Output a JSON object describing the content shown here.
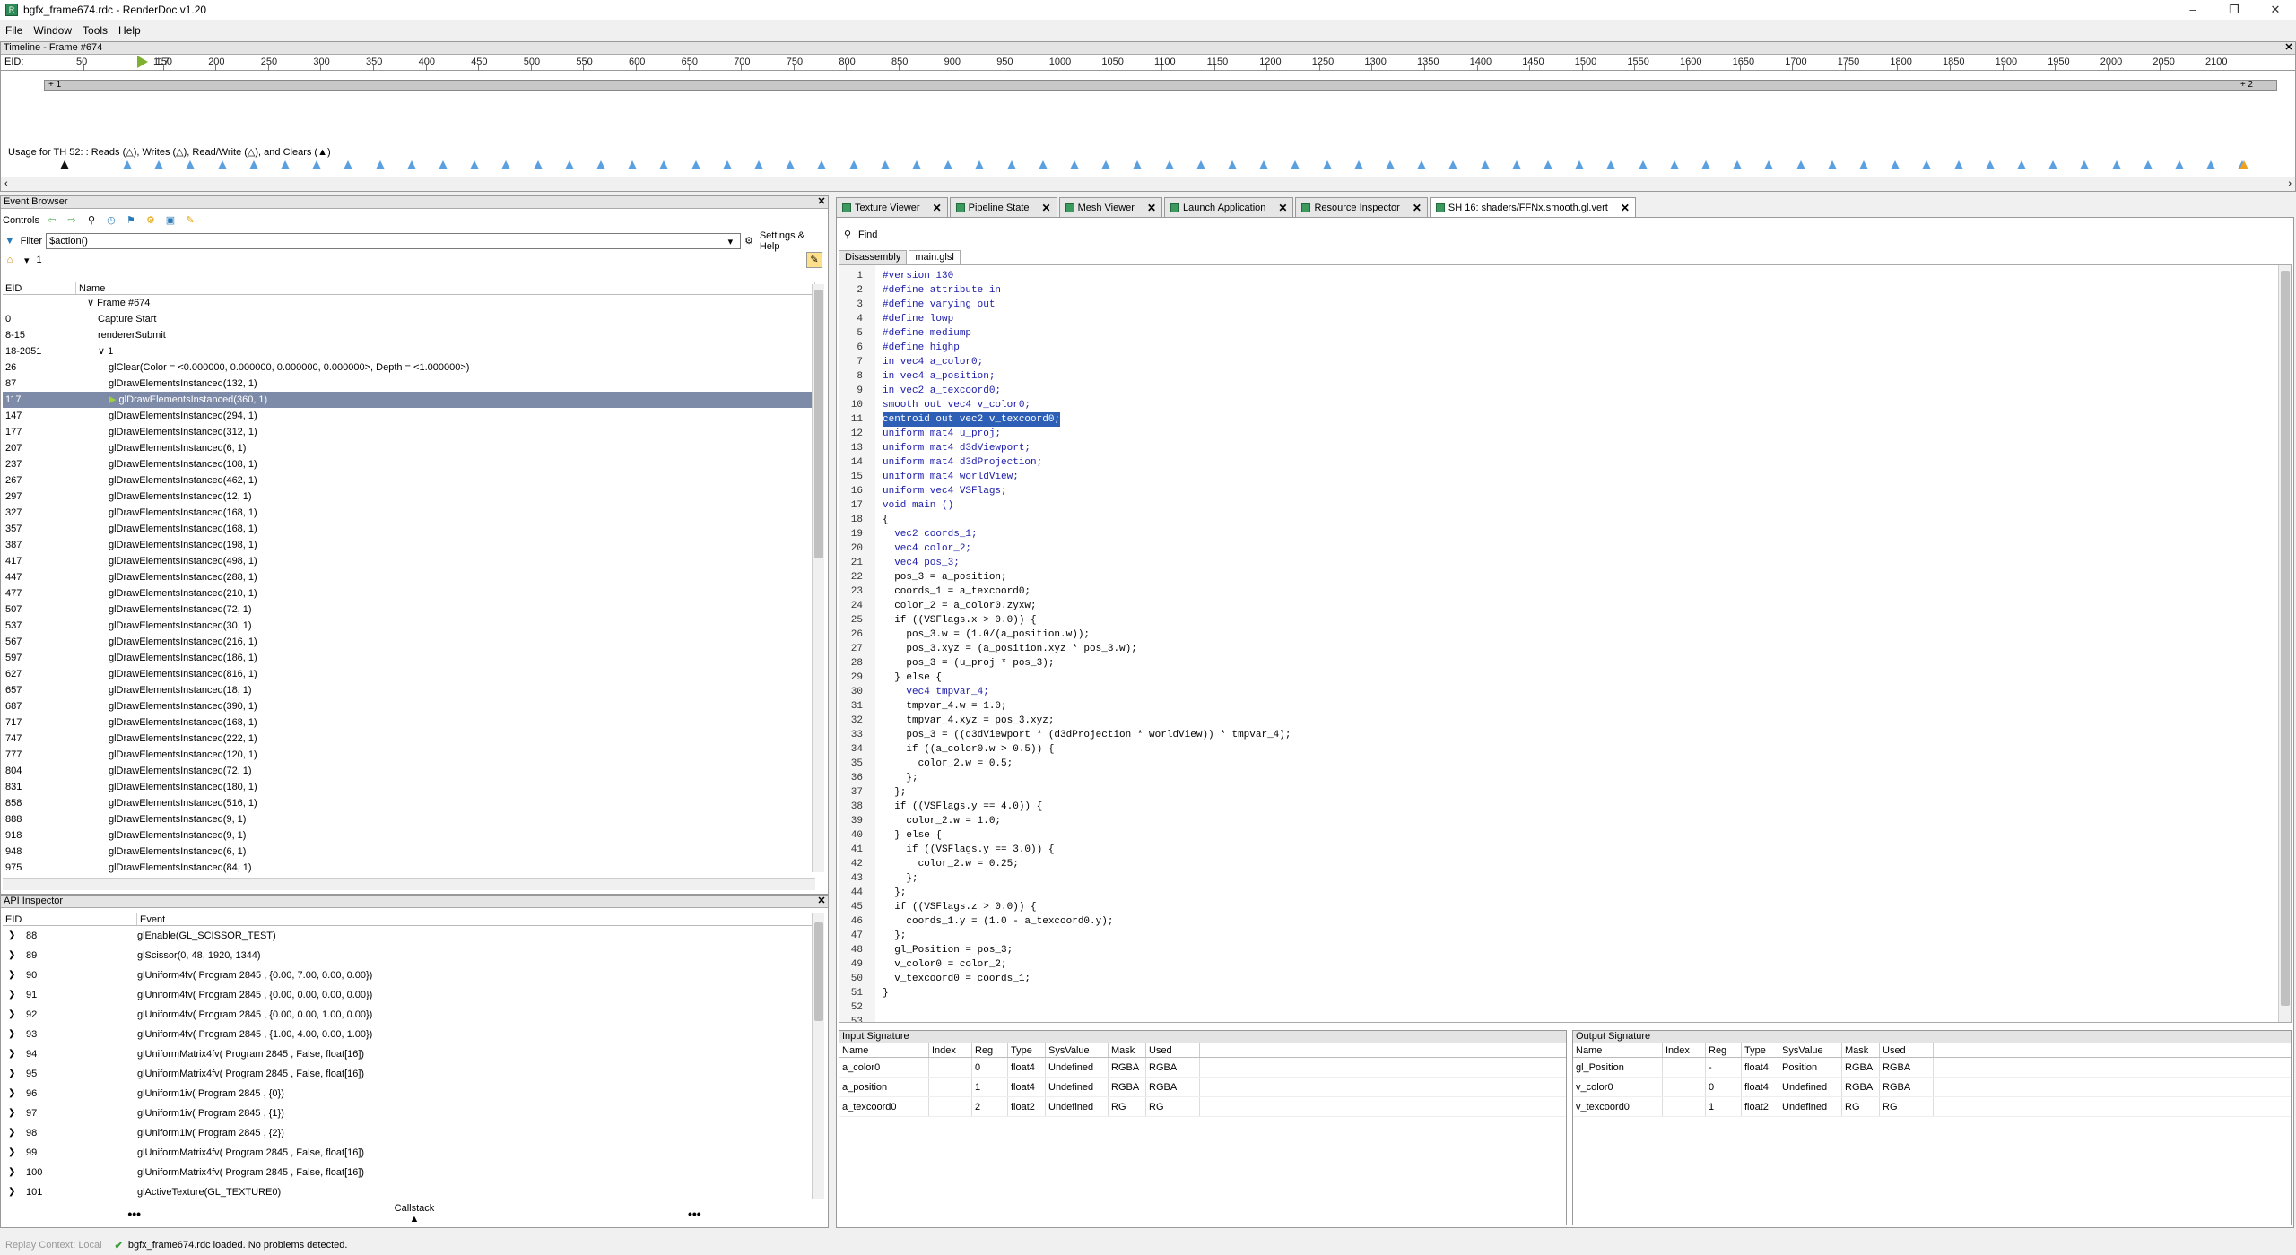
{
  "window": {
    "title": "bgfx_frame674.rdc - RenderDoc v1.20",
    "icon_text": "R"
  },
  "menu": [
    "File",
    "Window",
    "Tools",
    "Help"
  ],
  "timeline": {
    "title": "Timeline - Frame #674",
    "eid_label": "EID:",
    "ticks": [
      "50",
      "117",
      "150",
      "200",
      "250",
      "300",
      "350",
      "400",
      "450",
      "500",
      "550",
      "600",
      "650",
      "700",
      "750",
      "800",
      "850",
      "900",
      "950",
      "1000",
      "1050",
      "1100",
      "1150",
      "1200",
      "1250",
      "1300",
      "1350",
      "1400",
      "1450",
      "1500",
      "1550",
      "1600",
      "1650",
      "1700",
      "1750",
      "1800",
      "1850",
      "1900",
      "1950",
      "2000",
      "2050",
      "2100"
    ],
    "bar_left_label": "+ 1",
    "bar_right_label": "+ 2",
    "usage_text": "Usage for TH 52: : Reads (△), Writes (△), Read/Write (△), and Clears (▲)"
  },
  "event_browser": {
    "title": "Event Browser",
    "controls_label": "Controls",
    "filter_label": "Filter",
    "filter_value": "$action()",
    "settings_label": "Settings & Help",
    "bookmark_value": "1",
    "col_eid": "EID",
    "col_name": "Name",
    "rows": [
      {
        "eid": "",
        "name": "Frame #674",
        "indent": 1,
        "chev": "v"
      },
      {
        "eid": "0",
        "name": "Capture Start",
        "indent": 2,
        "chev": ""
      },
      {
        "eid": "8-15",
        "name": "rendererSubmit",
        "indent": 2,
        "chev": ""
      },
      {
        "eid": "18-2051",
        "name": "1",
        "indent": 2,
        "chev": "v"
      },
      {
        "eid": "26",
        "name": "glClear(Color = <0.000000, 0.000000, 0.000000, 0.000000>, Depth = <1.000000>)",
        "indent": 3,
        "chev": ""
      },
      {
        "eid": "87",
        "name": "glDrawElementsInstanced(132, 1)",
        "indent": 3,
        "chev": ""
      },
      {
        "eid": "117",
        "name": "glDrawElementsInstanced(360, 1)",
        "indent": 3,
        "chev": "",
        "selected": true
      },
      {
        "eid": "147",
        "name": "glDrawElementsInstanced(294, 1)",
        "indent": 3,
        "chev": ""
      },
      {
        "eid": "177",
        "name": "glDrawElementsInstanced(312, 1)",
        "indent": 3,
        "chev": ""
      },
      {
        "eid": "207",
        "name": "glDrawElementsInstanced(6, 1)",
        "indent": 3,
        "chev": ""
      },
      {
        "eid": "237",
        "name": "glDrawElementsInstanced(108, 1)",
        "indent": 3,
        "chev": ""
      },
      {
        "eid": "267",
        "name": "glDrawElementsInstanced(462, 1)",
        "indent": 3,
        "chev": ""
      },
      {
        "eid": "297",
        "name": "glDrawElementsInstanced(12, 1)",
        "indent": 3,
        "chev": ""
      },
      {
        "eid": "327",
        "name": "glDrawElementsInstanced(168, 1)",
        "indent": 3,
        "chev": ""
      },
      {
        "eid": "357",
        "name": "glDrawElementsInstanced(168, 1)",
        "indent": 3,
        "chev": ""
      },
      {
        "eid": "387",
        "name": "glDrawElementsInstanced(198, 1)",
        "indent": 3,
        "chev": ""
      },
      {
        "eid": "417",
        "name": "glDrawElementsInstanced(498, 1)",
        "indent": 3,
        "chev": ""
      },
      {
        "eid": "447",
        "name": "glDrawElementsInstanced(288, 1)",
        "indent": 3,
        "chev": ""
      },
      {
        "eid": "477",
        "name": "glDrawElementsInstanced(210, 1)",
        "indent": 3,
        "chev": ""
      },
      {
        "eid": "507",
        "name": "glDrawElementsInstanced(72, 1)",
        "indent": 3,
        "chev": ""
      },
      {
        "eid": "537",
        "name": "glDrawElementsInstanced(30, 1)",
        "indent": 3,
        "chev": ""
      },
      {
        "eid": "567",
        "name": "glDrawElementsInstanced(216, 1)",
        "indent": 3,
        "chev": ""
      },
      {
        "eid": "597",
        "name": "glDrawElementsInstanced(186, 1)",
        "indent": 3,
        "chev": ""
      },
      {
        "eid": "627",
        "name": "glDrawElementsInstanced(816, 1)",
        "indent": 3,
        "chev": ""
      },
      {
        "eid": "657",
        "name": "glDrawElementsInstanced(18, 1)",
        "indent": 3,
        "chev": ""
      },
      {
        "eid": "687",
        "name": "glDrawElementsInstanced(390, 1)",
        "indent": 3,
        "chev": ""
      },
      {
        "eid": "717",
        "name": "glDrawElementsInstanced(168, 1)",
        "indent": 3,
        "chev": ""
      },
      {
        "eid": "747",
        "name": "glDrawElementsInstanced(222, 1)",
        "indent": 3,
        "chev": ""
      },
      {
        "eid": "777",
        "name": "glDrawElementsInstanced(120, 1)",
        "indent": 3,
        "chev": ""
      },
      {
        "eid": "804",
        "name": "glDrawElementsInstanced(72, 1)",
        "indent": 3,
        "chev": ""
      },
      {
        "eid": "831",
        "name": "glDrawElementsInstanced(180, 1)",
        "indent": 3,
        "chev": ""
      },
      {
        "eid": "858",
        "name": "glDrawElementsInstanced(516, 1)",
        "indent": 3,
        "chev": ""
      },
      {
        "eid": "888",
        "name": "glDrawElementsInstanced(9, 1)",
        "indent": 3,
        "chev": ""
      },
      {
        "eid": "918",
        "name": "glDrawElementsInstanced(9, 1)",
        "indent": 3,
        "chev": ""
      },
      {
        "eid": "948",
        "name": "glDrawElementsInstanced(6, 1)",
        "indent": 3,
        "chev": ""
      },
      {
        "eid": "975",
        "name": "glDrawElementsInstanced(84, 1)",
        "indent": 3,
        "chev": ""
      }
    ]
  },
  "api_inspector": {
    "title": "API Inspector",
    "col_eid": "EID",
    "col_event": "Event",
    "rows": [
      {
        "eid": "88",
        "event": "glEnable(GL_SCISSOR_TEST)"
      },
      {
        "eid": "89",
        "event": "glScissor(0, 48, 1920, 1344)"
      },
      {
        "eid": "90",
        "event": "glUniform4fv( Program 2845 , {0.00, 7.00, 0.00, 0.00})"
      },
      {
        "eid": "91",
        "event": "glUniform4fv( Program 2845 , {0.00, 0.00, 0.00, 0.00})"
      },
      {
        "eid": "92",
        "event": "glUniform4fv( Program 2845 , {0.00, 0.00, 1.00, 0.00})"
      },
      {
        "eid": "93",
        "event": "glUniform4fv( Program 2845 , {1.00, 4.00, 0.00, 1.00})"
      },
      {
        "eid": "94",
        "event": "glUniformMatrix4fv( Program 2845 , False, float[16])"
      },
      {
        "eid": "95",
        "event": "glUniformMatrix4fv( Program 2845 , False, float[16])"
      },
      {
        "eid": "96",
        "event": "glUniform1iv( Program 2845 , {0})"
      },
      {
        "eid": "97",
        "event": "glUniform1iv( Program 2845 , {1})"
      },
      {
        "eid": "98",
        "event": "glUniform1iv( Program 2845 , {2})"
      },
      {
        "eid": "99",
        "event": "glUniformMatrix4fv( Program 2845 , False, float[16])"
      },
      {
        "eid": "100",
        "event": "glUniformMatrix4fv( Program 2845 , False, float[16])"
      },
      {
        "eid": "101",
        "event": "glActiveTexture(GL_TEXTURE0)"
      }
    ],
    "callstack_label": "Callstack",
    "more": "•••"
  },
  "tabs": [
    {
      "label": "Texture Viewer"
    },
    {
      "label": "Pipeline State"
    },
    {
      "label": "Mesh Viewer"
    },
    {
      "label": "Launch Application"
    },
    {
      "label": "Resource Inspector"
    },
    {
      "label": "SH 16: shaders/FFNx.smooth.gl.vert",
      "active": true
    }
  ],
  "shader": {
    "find_label": "Find",
    "subtabs": [
      "Disassembly",
      "main.glsl"
    ],
    "lines": [
      "#version 130",
      "#define attribute in",
      "#define varying out",
      "#define lowp",
      "#define mediump",
      "#define highp",
      "in vec4 a_color0;",
      "in vec4 a_position;",
      "in vec2 a_texcoord0;",
      "smooth out vec4 v_color0;",
      "centroid out vec2 v_texcoord0;",
      "uniform mat4 u_proj;",
      "uniform mat4 d3dViewport;",
      "uniform mat4 d3dProjection;",
      "uniform mat4 worldView;",
      "uniform vec4 VSFlags;",
      "void main ()",
      "{",
      "  vec2 coords_1;",
      "  vec4 color_2;",
      "  vec4 pos_3;",
      "  pos_3 = a_position;",
      "  coords_1 = a_texcoord0;",
      "  color_2 = a_color0.zyxw;",
      "  if ((VSFlags.x > 0.0)) {",
      "    pos_3.w = (1.0/(a_position.w));",
      "    pos_3.xyz = (a_position.xyz * pos_3.w);",
      "    pos_3 = (u_proj * pos_3);",
      "  } else {",
      "    vec4 tmpvar_4;",
      "    tmpvar_4.w = 1.0;",
      "    tmpvar_4.xyz = pos_3.xyz;",
      "    pos_3 = ((d3dViewport * (d3dProjection * worldView)) * tmpvar_4);",
      "    if ((a_color0.w > 0.5)) {",
      "      color_2.w = 0.5;",
      "    };",
      "  };",
      "  if ((VSFlags.y == 4.0)) {",
      "    color_2.w = 1.0;",
      "  } else {",
      "    if ((VSFlags.y == 3.0)) {",
      "      color_2.w = 0.25;",
      "    };",
      "  };",
      "  if ((VSFlags.z > 0.0)) {",
      "    coords_1.y = (1.0 - a_texcoord0.y);",
      "  };",
      "  gl_Position = pos_3;",
      "  v_color0 = color_2;",
      "  v_texcoord0 = coords_1;",
      "}",
      "",
      ""
    ],
    "highlight_line": 11
  },
  "input_signature": {
    "title": "Input Signature",
    "cols": [
      "Name",
      "Index",
      "Reg",
      "Type",
      "SysValue",
      "Mask",
      "Used"
    ],
    "rows": [
      [
        "a_color0",
        "",
        "0",
        "float4",
        "Undefined",
        "RGBA",
        "RGBA"
      ],
      [
        "a_position",
        "",
        "1",
        "float4",
        "Undefined",
        "RGBA",
        "RGBA"
      ],
      [
        "a_texcoord0",
        "",
        "2",
        "float2",
        "Undefined",
        "RG",
        "RG"
      ]
    ]
  },
  "output_signature": {
    "title": "Output Signature",
    "cols": [
      "Name",
      "Index",
      "Reg",
      "Type",
      "SysValue",
      "Mask",
      "Used"
    ],
    "rows": [
      [
        "gl_Position",
        "",
        "-",
        "float4",
        "Position",
        "RGBA",
        "RGBA"
      ],
      [
        "v_color0",
        "",
        "0",
        "float4",
        "Undefined",
        "RGBA",
        "RGBA"
      ],
      [
        "v_texcoord0",
        "",
        "1",
        "float2",
        "Undefined",
        "RG",
        "RG"
      ]
    ]
  },
  "status": {
    "context": "Replay Context: Local",
    "message": "bgfx_frame674.rdc loaded. No problems detected."
  },
  "colors": {
    "accent_green": "#3c9a5f",
    "selection": "#7d8aa8",
    "keyword": "#1a1aa8",
    "highlight": "#2d5fb6"
  }
}
